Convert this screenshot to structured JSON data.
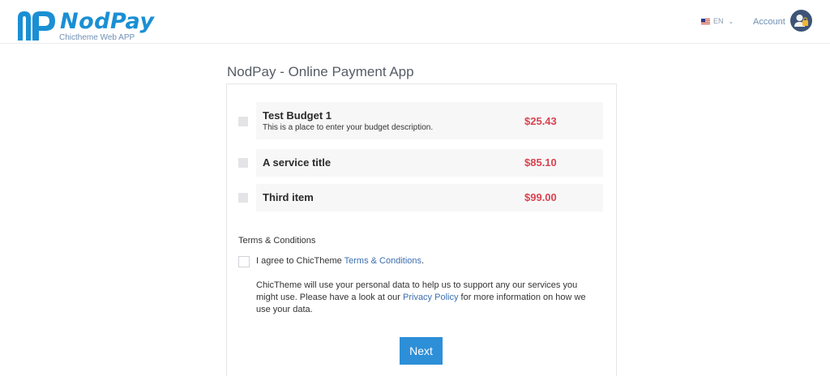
{
  "header": {
    "brand_name": "NodPay",
    "brand_subtitle": "Chictheme Web APP",
    "language": "EN",
    "account_label": "Account"
  },
  "main": {
    "title": "NodPay - Online Payment App",
    "items": [
      {
        "title": "Test Budget 1",
        "description": "This is a place to enter your budget description.",
        "price": "$25.43"
      },
      {
        "title": "A service title",
        "description": "",
        "price": "$85.10"
      },
      {
        "title": "Third item",
        "description": "",
        "price": "$99.00"
      }
    ],
    "terms": {
      "heading": "Terms & Conditions",
      "agree_prefix": "I agree to ChicTheme ",
      "agree_link": "Terms & Conditions",
      "agree_suffix": ".",
      "note_prefix": "ChicTheme will use your personal data to help us to support any our services you might use. Please have a look at our ",
      "note_link": "Privacy Policy",
      "note_suffix": " for more information on how we use your data."
    },
    "next_label": "Next"
  },
  "colors": {
    "accent": "#2d8fd8",
    "price": "#d9434f",
    "brand": "#1a8fd4",
    "link": "#3b6fb0"
  }
}
